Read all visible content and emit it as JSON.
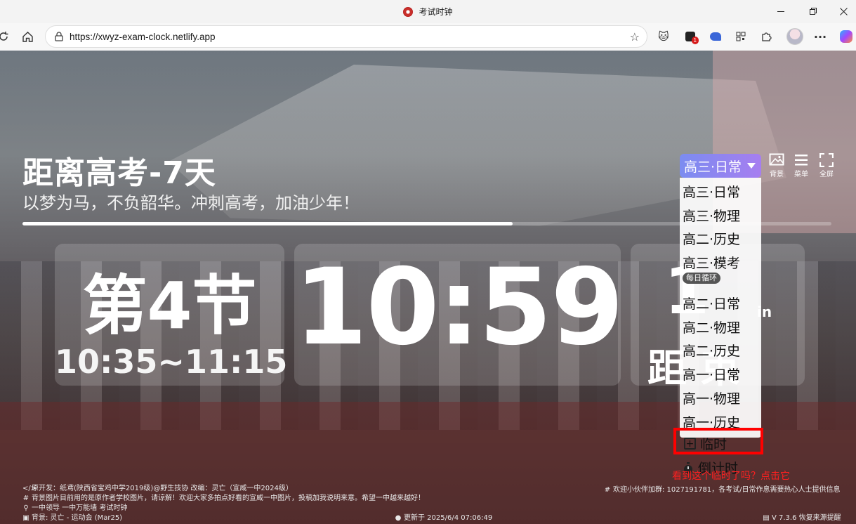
{
  "browser": {
    "window_title": "考试时钟",
    "url": "https://xwyz-exam-clock.netlify.app",
    "extension_badge_count": "1"
  },
  "page": {
    "main_title": "距离高考-7天",
    "subtitle": "以梦为马，不负韶华。冲刺高考，加油少年！",
    "progress_fraction": 0.606,
    "period_label": "第4节",
    "period_time": "10:35~11:15",
    "clock_time": "10:59",
    "remaining_value": "1",
    "remaining_unit": "in",
    "remaining_caption": "距   束"
  },
  "controls": {
    "schedule_selected": "高三·日常",
    "background_label": "背景",
    "menu_label": "菜单",
    "fullscreen_label": "全屏"
  },
  "dropdown": {
    "items": [
      "高三·日常",
      "高三·物理",
      "高二·历史",
      "高三·模考",
      "高二·日常",
      "高二·物理",
      "高二·历史",
      "高一·日常",
      "高一·物理",
      "高一·历史"
    ],
    "loop_tag": "每日循环",
    "temporary_label": "临时",
    "countdown_label": "倒计时",
    "hint": "看到这个临时了吗？点击它"
  },
  "footer": {
    "dev_line": "原开发：纸鸢(陕西省宝鸡中学2019级)@野生技协   改编：灵亡（宣威一中2024级）",
    "bg_note": "背景图片目前用的是原作者学校图片，请谅解！欢迎大家多拍点好看的宣威一中图片，投稿加我说明来意。希望一中越来越好！",
    "org_line": "一中领导 一中万能墙 考试时钟",
    "bg_credit": "背景: 灵亡 - 运动会 (Mar25)",
    "updated": "更新于 2025/6/4 07:06:49",
    "recruit": "欢迎小伙伴加群: 1027191781，各考试/日常作息需要热心人士提供信息",
    "version": "V 7.3.6 恢复来源提醒"
  }
}
